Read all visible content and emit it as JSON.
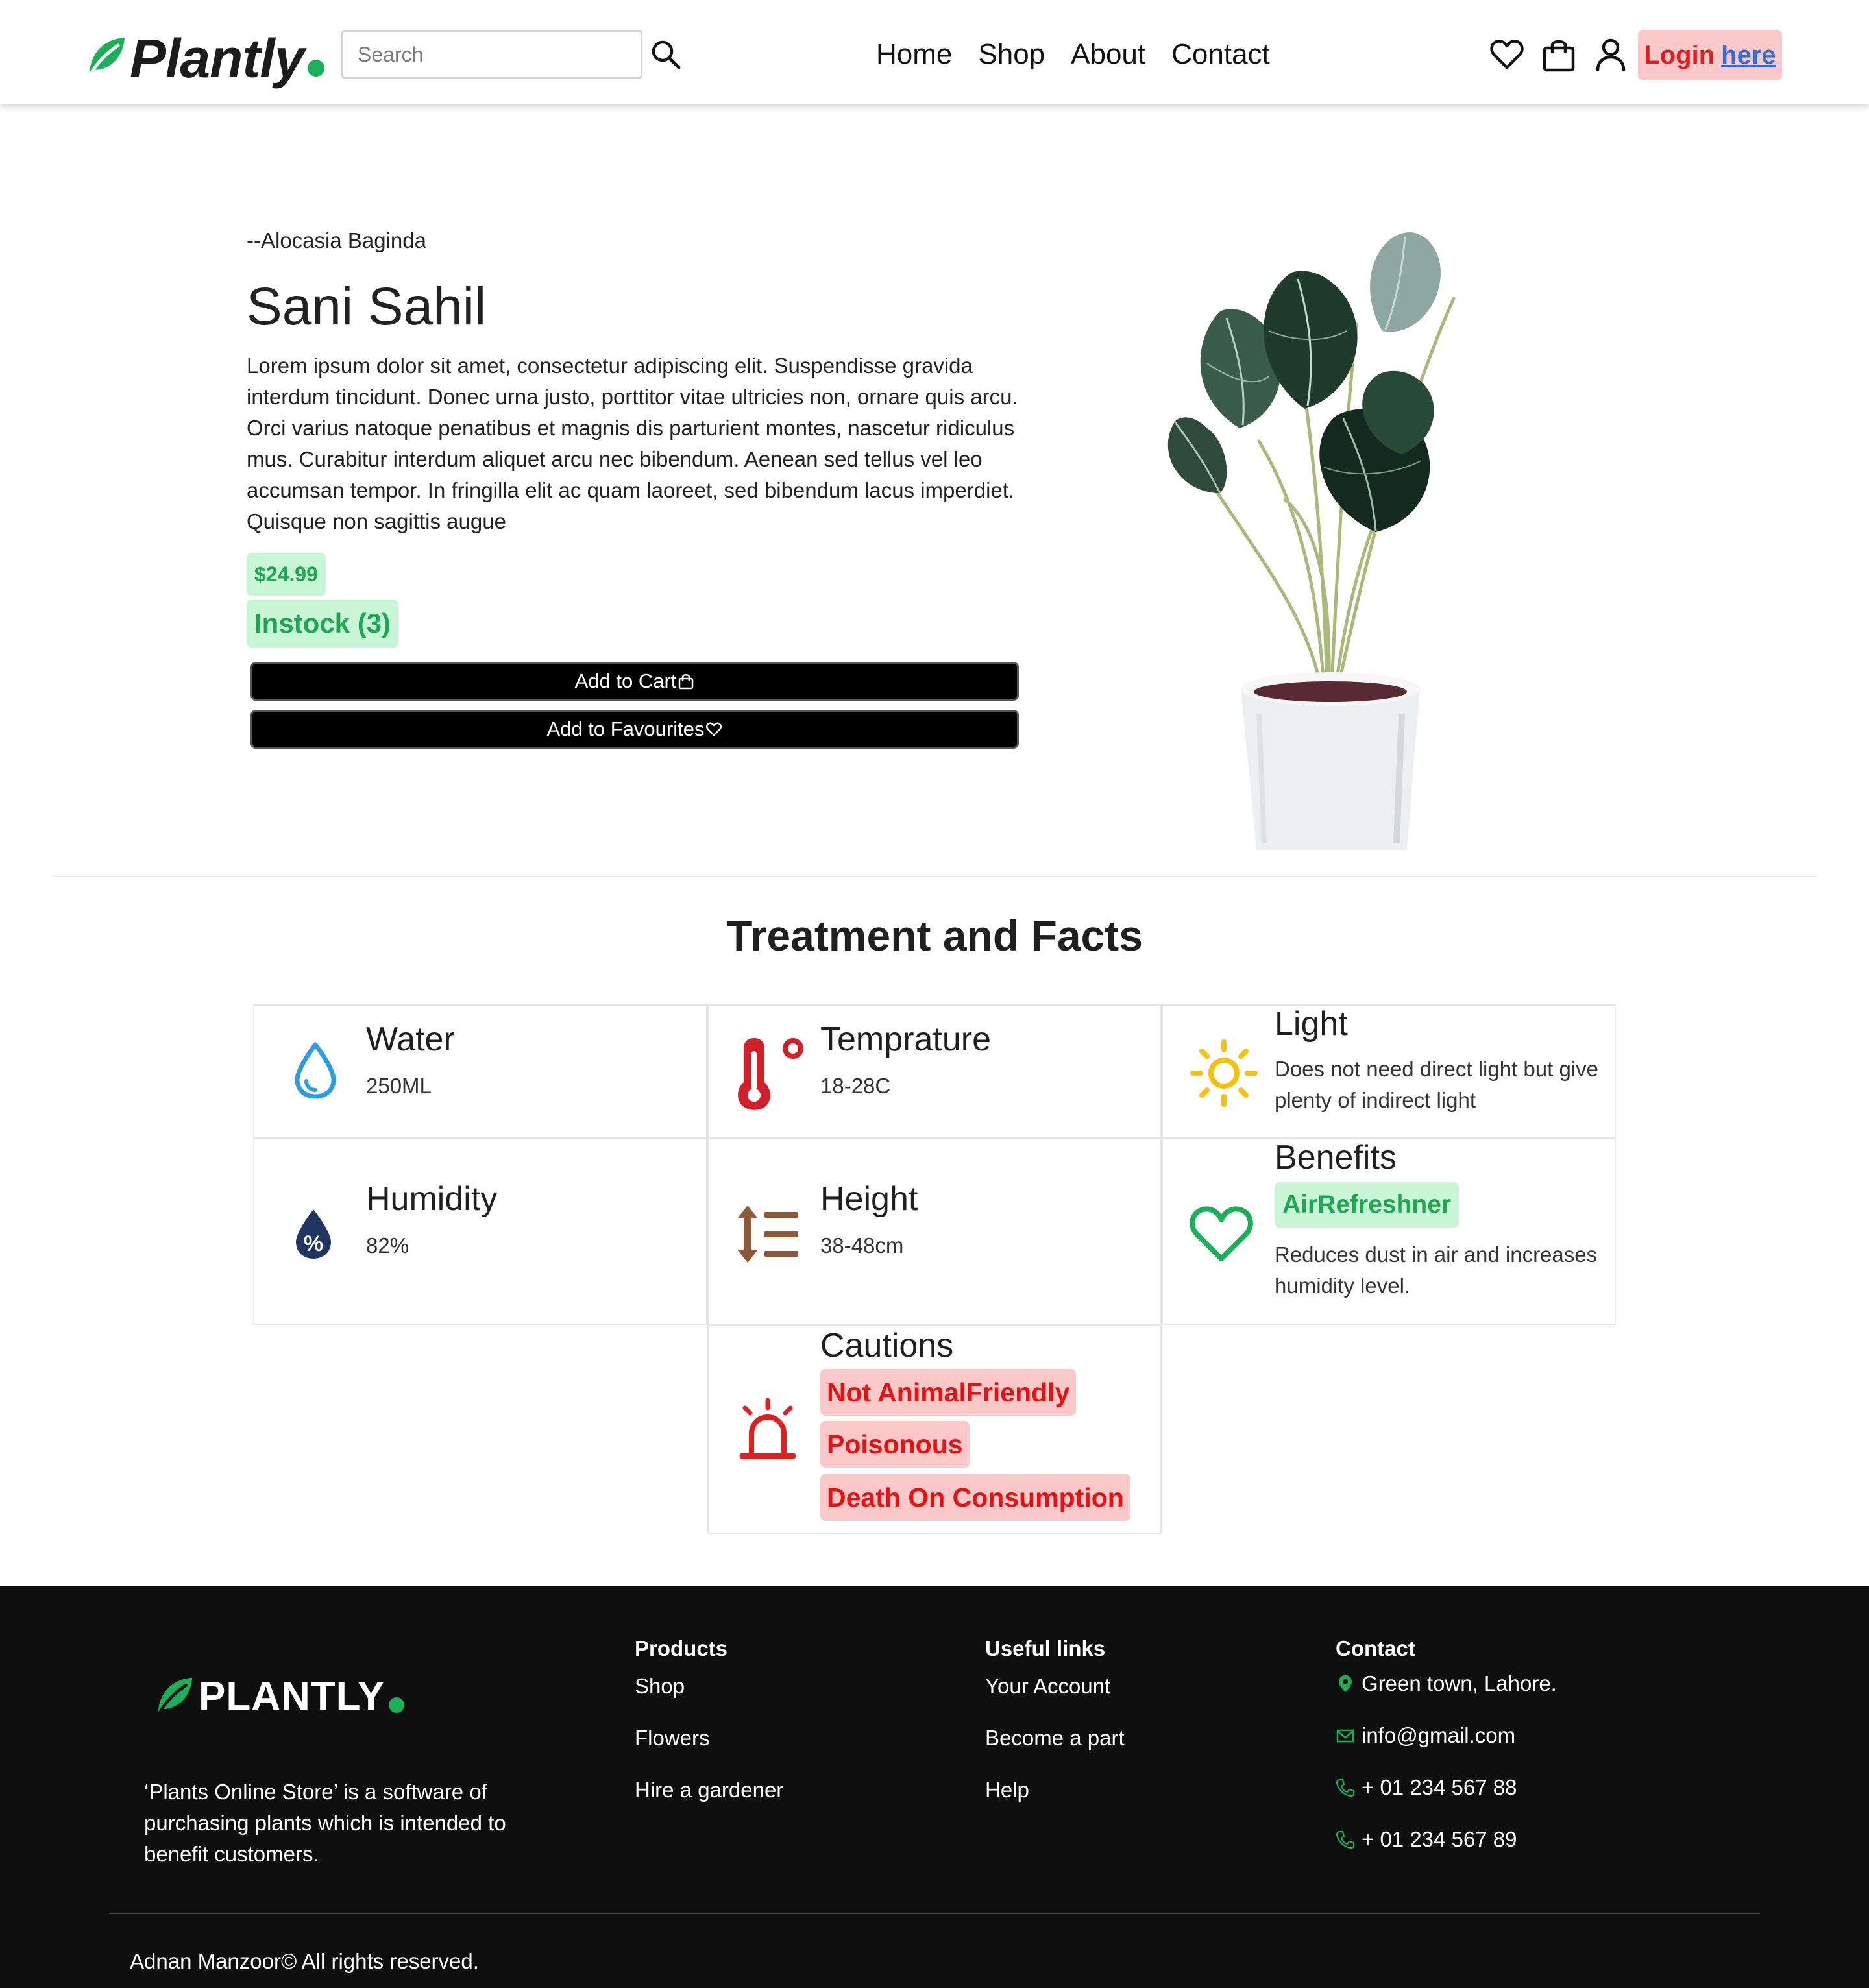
{
  "header": {
    "brand": "Plantly",
    "search_placeholder": "Search",
    "nav": [
      "Home",
      "Shop",
      "About",
      "Contact"
    ],
    "login_label": "Login",
    "login_link": "here"
  },
  "product": {
    "subtitle": "--Alocasia Baginda",
    "title": "Sani Sahil",
    "description": "Lorem ipsum dolor sit amet, consectetur adipiscing elit. Suspendisse gravida interdum tincidunt. Donec urna justo, porttitor vitae ultricies non, ornare quis arcu. Orci varius natoque penatibus et magnis dis parturient montes, nascetur ridiculus mus. Curabitur interdum aliquet arcu nec bibendum. Aenean sed tellus vel leo accumsan tempor. In fringilla elit ac quam laoreet, sed bibendum lacus imperdiet. Quisque non sagittis augue",
    "price": "$24.99",
    "stock": "Instock (3)",
    "add_to_cart": "Add to Cart",
    "add_to_favourites": "Add to Favourites"
  },
  "facts": {
    "title": "Treatment and Facts",
    "water": {
      "title": "Water",
      "value": "250ML"
    },
    "temperature": {
      "title": "Temprature",
      "value": "18-28C"
    },
    "light": {
      "title": "Light",
      "value": "Does not need direct light but give plenty of indirect light"
    },
    "humidity": {
      "title": "Humidity",
      "value": "82%"
    },
    "height": {
      "title": "Height",
      "value": "38-48cm"
    },
    "benefits": {
      "title": "Benefits",
      "tag": "AirRefreshner",
      "value": "Reduces dust in air and increases humidity level."
    },
    "cautions": {
      "title": "Cautions",
      "tags": [
        "Not AnimalFriendly",
        "Poisonous",
        "Death On Consumption"
      ]
    }
  },
  "footer": {
    "brand": "PLANTLY",
    "about": "‘Plants Online Store’ is a software of purchasing plants which is intended to benefit customers.",
    "products": {
      "heading": "Products",
      "links": [
        "Shop",
        "Flowers",
        "Hire a gardener"
      ]
    },
    "useful": {
      "heading": "Useful links",
      "links": [
        "Your Account",
        "Become a part",
        "Help"
      ]
    },
    "contact": {
      "heading": "Contact",
      "address": "Green town, Lahore.",
      "email": "info@gmail.com",
      "phone1": "+ 01 234 567 88",
      "phone2": "+ 01 234 567 89"
    },
    "copyright": "Adnan Manzoor© All rights reserved."
  },
  "colors": {
    "brand_green": "#1ab058",
    "badge_green_bg": "#c8f5d6",
    "badge_green_text": "#1ea653",
    "caution_bg": "#f9c9c9",
    "caution_text": "#e81010",
    "footer_bg": "#0f0f0f"
  },
  "icons": [
    "leaf-icon",
    "search-icon",
    "heart-icon",
    "bag-icon",
    "user-icon",
    "water-drop-icon",
    "thermometer-icon",
    "sun-icon",
    "humidity-icon",
    "height-icon",
    "benefit-heart-icon",
    "alarm-icon",
    "location-icon",
    "mail-icon",
    "phone-icon"
  ]
}
